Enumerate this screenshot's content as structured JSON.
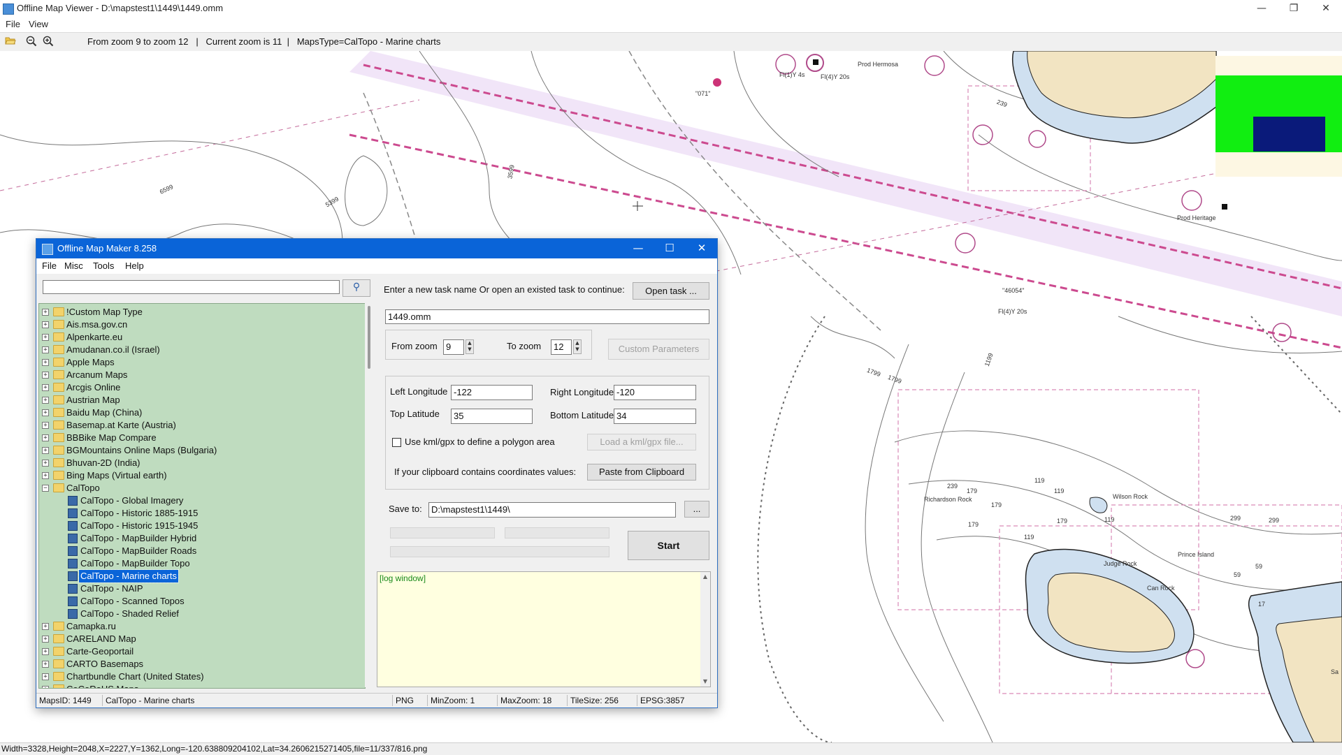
{
  "window": {
    "title": "Offline Map Viewer - D:\\mapstest1\\1449\\1449.omm",
    "minimize": "—",
    "maximize": "❐",
    "close": "✕"
  },
  "menu": {
    "file": "File",
    "view": "View"
  },
  "toolbar": {
    "open_icon": "folder-open-icon",
    "zoom_out_icon": "zoom-out-icon",
    "zoom_in_icon": "zoom-in-icon",
    "info": "From zoom 9 to zoom 12   |   Current zoom is 11  |   MapsType=CalTopo - Marine charts"
  },
  "map": {
    "labels": [
      "Prod Hermosa",
      "Fl(1)Y 4s",
      "Fl(4)Y 20s",
      "\"071\"",
      "6599",
      "3599",
      "5399",
      "239",
      "Prod Heritage",
      "\"46054\"",
      "Fl(4)Y 20s",
      "1199",
      "1799",
      "1799",
      "239",
      "179",
      "179",
      "Richardson Rock",
      "179",
      "119",
      "119",
      "179",
      "Wilson Rock",
      "119",
      "299",
      "299",
      "119",
      "Judge Rock",
      "Prince Island",
      "Can Rock",
      "59",
      "59",
      "17",
      "Sa"
    ]
  },
  "statusbar": {
    "text": "Width=3328,Height=2048,X=2227,Y=1362,Long=-120.638809204102,Lat=34.2606215271405,file=11/337/816.png"
  },
  "dialog": {
    "title": "Offline Map Maker 8.258",
    "title_buttons": {
      "minimize": "—",
      "maximize": "☐",
      "close": "✕"
    },
    "menu": {
      "file": "File",
      "misc": "Misc",
      "tools": "Tools",
      "help": "Help"
    },
    "search": {
      "value": "",
      "icon": "search-icon"
    },
    "tree": [
      {
        "label": "!Custom Map Type",
        "level": 0,
        "expander": "+"
      },
      {
        "label": "Ais.msa.gov.cn",
        "level": 0,
        "expander": "+"
      },
      {
        "label": "Alpenkarte.eu",
        "level": 0,
        "expander": "+"
      },
      {
        "label": "Amudanan.co.il (Israel)",
        "level": 0,
        "expander": "+"
      },
      {
        "label": "Apple Maps",
        "level": 0,
        "expander": "+"
      },
      {
        "label": "Arcanum Maps",
        "level": 0,
        "expander": "+"
      },
      {
        "label": "Arcgis Online",
        "level": 0,
        "expander": "+"
      },
      {
        "label": "Austrian Map",
        "level": 0,
        "expander": "+"
      },
      {
        "label": "Baidu Map (China)",
        "level": 0,
        "expander": "+"
      },
      {
        "label": "Basemap.at Karte (Austria)",
        "level": 0,
        "expander": "+"
      },
      {
        "label": "BBBike Map Compare",
        "level": 0,
        "expander": "+"
      },
      {
        "label": "BGMountains Online Maps (Bulgaria)",
        "level": 0,
        "expander": "+"
      },
      {
        "label": "Bhuvan-2D (India)",
        "level": 0,
        "expander": "+"
      },
      {
        "label": "Bing Maps (Virtual earth)",
        "level": 0,
        "expander": "+"
      },
      {
        "label": "CalTopo",
        "level": 0,
        "expander": "−"
      },
      {
        "label": "CalTopo - Global Imagery",
        "level": 1,
        "expander": ""
      },
      {
        "label": "CalTopo - Historic 1885-1915",
        "level": 1,
        "expander": ""
      },
      {
        "label": "CalTopo - Historic 1915-1945",
        "level": 1,
        "expander": ""
      },
      {
        "label": "CalTopo - MapBuilder Hybrid",
        "level": 1,
        "expander": ""
      },
      {
        "label": "CalTopo - MapBuilder Roads",
        "level": 1,
        "expander": ""
      },
      {
        "label": "CalTopo - MapBuilder Topo",
        "level": 1,
        "expander": ""
      },
      {
        "label": "CalTopo - Marine charts",
        "level": 1,
        "expander": "",
        "selected": true
      },
      {
        "label": "CalTopo - NAIP",
        "level": 1,
        "expander": ""
      },
      {
        "label": "CalTopo - Scanned Topos",
        "level": 1,
        "expander": ""
      },
      {
        "label": "CalTopo - Shaded Relief",
        "level": 1,
        "expander": ""
      },
      {
        "label": "Camapka.ru",
        "level": 0,
        "expander": "+"
      },
      {
        "label": "CARELAND Map",
        "level": 0,
        "expander": "+"
      },
      {
        "label": "Carte-Geoportail",
        "level": 0,
        "expander": "+"
      },
      {
        "label": "CARTO Basemaps",
        "level": 0,
        "expander": "+"
      },
      {
        "label": "Chartbundle Chart (United States)",
        "level": 0,
        "expander": "+"
      },
      {
        "label": "CoCoRaHS Maps",
        "level": 0,
        "expander": "+"
      }
    ],
    "task": {
      "prompt": "Enter a new task name Or open an existed task to continue:",
      "open_button": "Open task ...",
      "name": "1449.omm"
    },
    "zoom": {
      "from_label": "From zoom",
      "from_value": "9",
      "to_label": "To zoom",
      "to_value": "12",
      "custom_button": "Custom Parameters"
    },
    "coords": {
      "left_lon_label": "Left Longitude",
      "left_lon": "-122",
      "right_lon_label": "Right Longitude",
      "right_lon": "-120",
      "top_lat_label": "Top Latitude",
      "top_lat": "35",
      "bottom_lat_label": "Bottom Latitude",
      "bottom_lat": "34",
      "kml_label": "Use kml/gpx to define a polygon area",
      "kml_button": "Load a kml/gpx file...",
      "clipboard_label": "If your clipboard contains coordinates values:",
      "clipboard_button": "Paste from Clipboard"
    },
    "save": {
      "label": "Save to:",
      "path": "D:\\mapstest1\\1449\\",
      "browse_button": "..."
    },
    "start_button": "Start",
    "log": {
      "text": "[log window]"
    },
    "status": {
      "maps_id": "MapsID: 1449",
      "map_name": "CalTopo - Marine charts",
      "format": "PNG",
      "min_zoom": "MinZoom: 1",
      "max_zoom": "MaxZoom: 18",
      "tile_size": "TileSize: 256",
      "epsg": "EPSG:3857"
    }
  }
}
